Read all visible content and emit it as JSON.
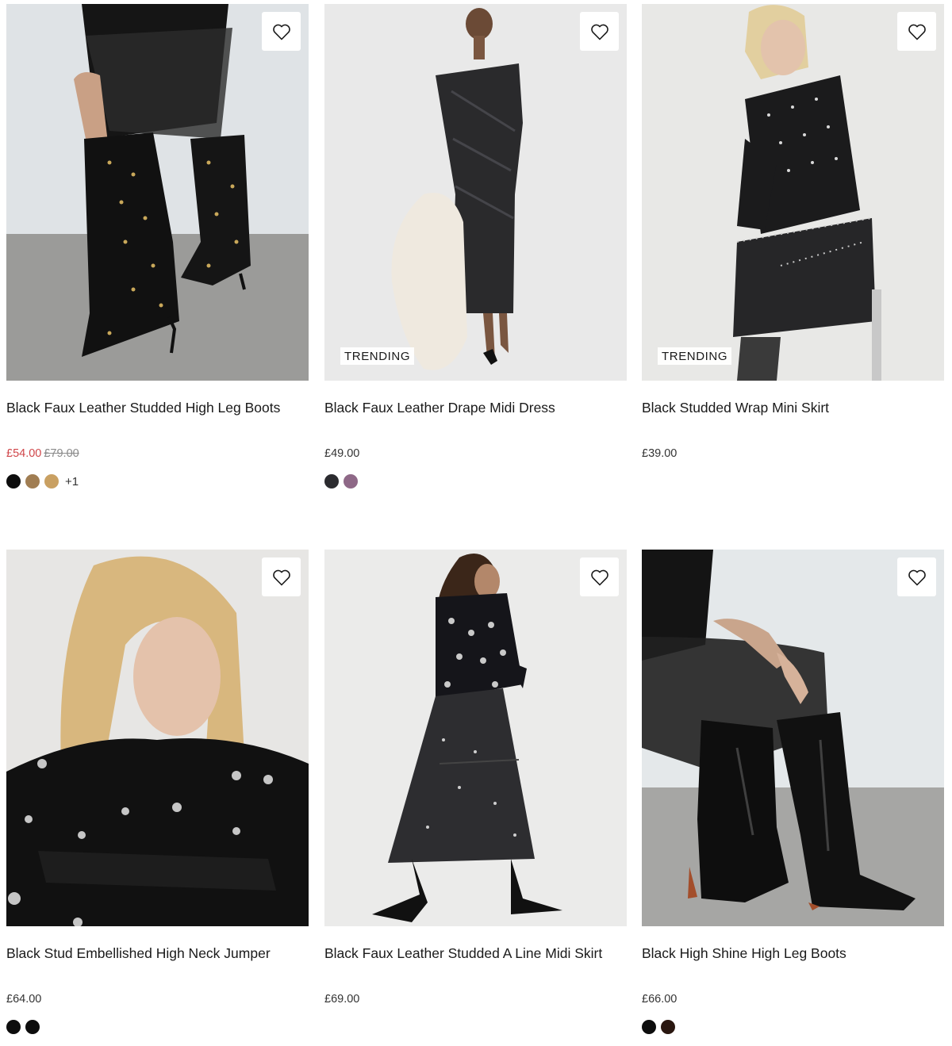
{
  "products": [
    {
      "title": "Black Faux Leather Studded High Leg Boots",
      "price": "£54.00",
      "was_price": "£79.00",
      "badge": "",
      "image_alt": "Black studded knee high boots",
      "swatches": [
        "#0d0d0d",
        "#a07d52",
        "#c9a062"
      ],
      "more_swatches": "+1"
    },
    {
      "title": "Black Faux Leather Drape Midi Dress",
      "price": "£49.00",
      "was_price": "",
      "badge": "TRENDING",
      "image_alt": "Model in black faux leather drape midi dress",
      "swatches": [
        "#2b2b2f",
        "#8e6887"
      ],
      "more_swatches": ""
    },
    {
      "title": "Black Studded Wrap Mini Skirt",
      "price": "£39.00",
      "was_price": "",
      "badge": "TRENDING",
      "image_alt": "Model in black studded wrap mini skirt",
      "swatches": [],
      "more_swatches": ""
    },
    {
      "title": "Black Stud Embellished High Neck Jumper",
      "price": "£64.00",
      "was_price": "",
      "badge": "",
      "image_alt": "Model in black stud embellished jumper",
      "swatches": [
        "#0d0d0d",
        "#0d0d0d"
      ],
      "more_swatches": ""
    },
    {
      "title": "Black Faux Leather Studded A Line Midi Skirt",
      "price": "£69.00",
      "was_price": "",
      "badge": "",
      "image_alt": "Model in black faux leather studded a line midi skirt",
      "swatches": [],
      "more_swatches": ""
    },
    {
      "title": "Black High Shine High Leg Boots",
      "price": "£66.00",
      "was_price": "",
      "badge": "",
      "image_alt": "Black high shine knee high boots",
      "swatches": [
        "#0d0d0d",
        "#2a1710"
      ],
      "more_swatches": ""
    }
  ],
  "icons": {
    "wishlist": "heart-outline-icon"
  },
  "colors": {
    "sale_price": "#d0464a",
    "text": "#1a1a1a",
    "was_price": "#8a8a8a"
  }
}
